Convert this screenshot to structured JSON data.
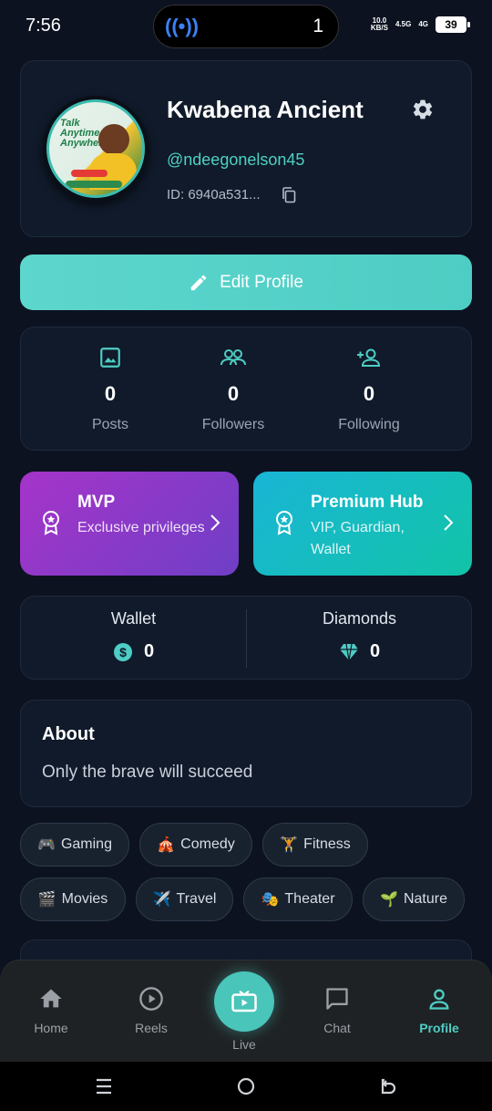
{
  "status_bar": {
    "time": "7:56",
    "island_number": "1",
    "net_speed_top": "10.0",
    "net_speed_unit": "KB/S",
    "net1": "4.5G",
    "net2": "4G",
    "battery": "39"
  },
  "profile": {
    "name": "Kwabena Ancient",
    "handle": "@ndeegonelson45",
    "id_text": "ID: 6940a531...",
    "avatar_text": "Talk Anytime, Anywhere!"
  },
  "edit_profile": {
    "label": "Edit Profile"
  },
  "stats": [
    {
      "value": "0",
      "label": "Posts"
    },
    {
      "value": "0",
      "label": "Followers"
    },
    {
      "value": "0",
      "label": "Following"
    }
  ],
  "promos": {
    "mvp": {
      "title": "MVP",
      "subtitle": "Exclusive privileges"
    },
    "hub": {
      "title": "Premium Hub",
      "subtitle": "VIP, Guardian, Wallet"
    }
  },
  "wallet": {
    "wallet_title": "Wallet",
    "wallet_value": "0",
    "diamonds_title": "Diamonds",
    "diamonds_value": "0"
  },
  "about": {
    "title": "About",
    "text": "Only the brave will succeed"
  },
  "interests": [
    {
      "emoji": "🎮",
      "label": "Gaming"
    },
    {
      "emoji": "🎪",
      "label": "Comedy"
    },
    {
      "emoji": "🏋️",
      "label": "Fitness"
    },
    {
      "emoji": "🎬",
      "label": "Movies"
    },
    {
      "emoji": "✈️",
      "label": "Travel"
    },
    {
      "emoji": "🎭",
      "label": "Theater"
    },
    {
      "emoji": "🌱",
      "label": "Nature"
    }
  ],
  "nav": {
    "home": "Home",
    "reels": "Reels",
    "live": "Live",
    "chat": "Chat",
    "profile": "Profile"
  },
  "colors": {
    "accent": "#4ecdc4",
    "background": "#0c1220",
    "card": "#101a2a",
    "mvp_gradient": [
      "#a634c9",
      "#6f3fc6"
    ],
    "hub_gradient": [
      "#19b5d5",
      "#12c4a8"
    ]
  }
}
